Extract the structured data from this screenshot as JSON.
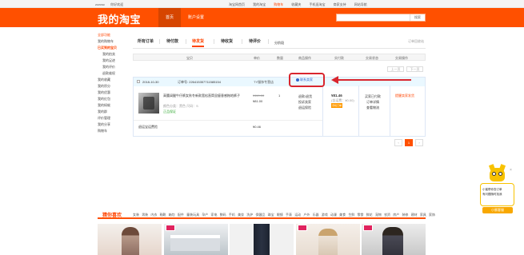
{
  "topbar": {
    "left": [
      "zzzcsc",
      "你好欢迎"
    ],
    "right": [
      "淘宝网首页",
      "我的淘宝",
      "购物车",
      "收藏夹",
      "手机逛淘宝",
      "商家支持",
      "网站导航"
    ]
  },
  "header": {
    "logo": "我的淘宝",
    "nav": [
      "首页",
      "账户设置"
    ],
    "search_button": "搜索"
  },
  "sidebar": {
    "items": [
      {
        "label": "全部功能",
        "style": "red"
      },
      {
        "label": "我的购物车",
        "style": ""
      },
      {
        "label": "已买到的宝贝",
        "style": "cur"
      },
      {
        "label": "我的拍卖",
        "style": "sub"
      },
      {
        "label": "我的足迹",
        "style": "sub"
      },
      {
        "label": "我的评价",
        "style": "sub"
      },
      {
        "label": "退款维权",
        "style": "sub"
      },
      {
        "label": "我的收藏",
        "style": ""
      },
      {
        "label": "我的积分",
        "style": ""
      },
      {
        "label": "我的优惠",
        "style": ""
      },
      {
        "label": "我的红包",
        "style": ""
      },
      {
        "label": "我的蚂蚁",
        "style": ""
      },
      {
        "label": "我的群",
        "style": ""
      },
      {
        "label": "评价管理",
        "style": ""
      },
      {
        "label": "我的分享",
        "style": ""
      },
      {
        "label": "购物车",
        "style": ""
      }
    ]
  },
  "tabs": {
    "items": [
      "所有订单",
      "待付款",
      "待发货",
      "待收货",
      "待评价",
      "分阶段"
    ],
    "active_index": 2,
    "recycle": "订单回收站"
  },
  "table_header": [
    "宝贝",
    "单价",
    "数量",
    "商品操作",
    "实付款",
    "交易状态",
    "交易操作"
  ],
  "pager_top": [
    "上一页",
    "下一页"
  ],
  "order": {
    "date": "2018-10-30",
    "number": "订单号: 226415357711585154",
    "shop": "TY服饰专营店",
    "help_label": "联系卖家",
    "product_title": "高腰阔腿牛仔裤女秋冬新款宽松直筒显瘦垂感拖地裤子",
    "product_spec": "颜色分类：黑色 尺码：S",
    "product_badge": "正品保证",
    "price_old": "¥119.00",
    "price_new": "¥81.00",
    "qty": "1",
    "service": [
      "退款/退货",
      "投诉卖家",
      "退运保险"
    ],
    "paid_amount": "¥81.46",
    "paid_note": "(含运费：¥0.00)",
    "paid_tag": "手机订单",
    "status": [
      "买家已付款",
      "订单详情",
      "查看物流"
    ],
    "action": "提醒卖家发货",
    "insurance_label": "退运宝运费险",
    "insurance_price": "¥0.46"
  },
  "pager_bottom": [
    "‹",
    "1",
    "›"
  ],
  "mascot": {
    "bubble": [
      "小蜜帮你查订单",
      "有问题随时找我"
    ],
    "button": "小蜜客服"
  },
  "footer": {
    "label": "猜你喜欢",
    "links": [
      "女装",
      "男装",
      "内衣",
      "鞋靴",
      "箱包",
      "配件",
      "童装玩具",
      "孕产",
      "家电",
      "数码",
      "手机",
      "美妆",
      "洗护",
      "保健品",
      "珠宝",
      "眼镜",
      "手表",
      "运动",
      "户外",
      "乐器",
      "游戏",
      "动漫",
      "美食",
      "生鲜",
      "零食",
      "鲜花",
      "宠物",
      "农资",
      "房产",
      "装修",
      "建材",
      "家具",
      "家饰"
    ]
  },
  "colors": {
    "brand": "#ff5000",
    "highlight": "#d9262e",
    "link": "#3366cc"
  }
}
